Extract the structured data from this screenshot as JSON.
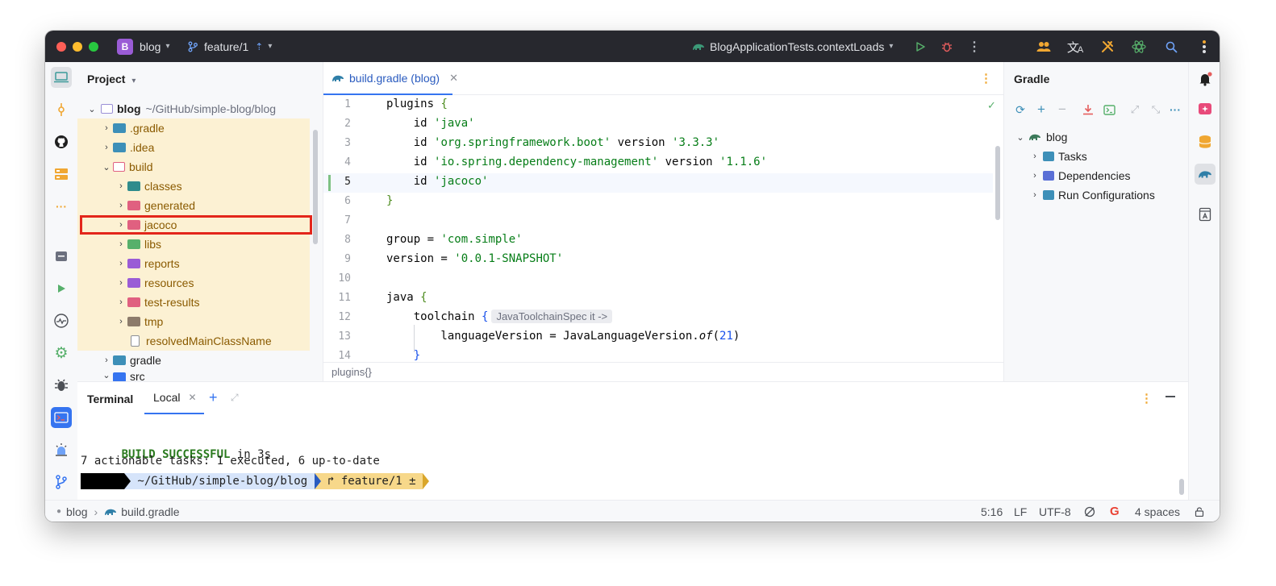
{
  "titlebar": {
    "project_badge": "B",
    "project_name": "blog",
    "branch": "feature/1",
    "run_config": "BlogApplicationTests.contextLoads"
  },
  "project_panel": {
    "title": "Project",
    "tree": [
      {
        "label": "blog",
        "hint": "~/GitHub/simple-blog/blog",
        "expanded": true
      },
      {
        "label": ".gradle"
      },
      {
        "label": ".idea"
      },
      {
        "label": "build",
        "expanded": true
      },
      {
        "label": "classes"
      },
      {
        "label": "generated"
      },
      {
        "label": "jacoco"
      },
      {
        "label": "libs"
      },
      {
        "label": "reports"
      },
      {
        "label": "resources"
      },
      {
        "label": "test-results"
      },
      {
        "label": "tmp"
      },
      {
        "label": "resolvedMainClassName"
      },
      {
        "label": "gradle"
      },
      {
        "label": "src",
        "expanded": true
      }
    ]
  },
  "editor": {
    "tab_label": "build.gradle (blog)",
    "line_numbers": [
      "1",
      "2",
      "3",
      "4",
      "5",
      "6",
      "7",
      "8",
      "9",
      "10",
      "11",
      "12",
      "13",
      "14"
    ],
    "code": {
      "l1_kw": "plugins ",
      "l1_br": "{",
      "l2_a": "    id ",
      "l2_s": "'java'",
      "l3_a": "    id ",
      "l3_s": "'org.springframework.boot'",
      "l3_b": " version ",
      "l3_s2": "'3.3.3'",
      "l4_a": "    id ",
      "l4_s": "'io.spring.dependency-management'",
      "l4_b": " version ",
      "l4_s2": "'1.1.6'",
      "l5_a": "    id ",
      "l5_s": "'jacoco'",
      "l6_br": "}",
      "l8_a": "group = ",
      "l8_s": "'com.simple'",
      "l9_a": "version = ",
      "l9_s": "'0.0.1-SNAPSHOT'",
      "l11_a": "java ",
      "l11_br": "{",
      "l12_a": "    toolchain ",
      "l12_br": "{",
      "l12_hint": "JavaToolchainSpec it ->",
      "l13_a": "        languageVersion = JavaLanguageVersion.",
      "l13_i": "of",
      "l13_p": "(",
      "l13_n": "21",
      "l13_c": ")",
      "l14_br": "    }"
    },
    "breadcrumb": "plugins{}"
  },
  "gradle_panel": {
    "title": "Gradle",
    "tree": [
      {
        "label": "blog",
        "expanded": true
      },
      {
        "label": "Tasks"
      },
      {
        "label": "Dependencies"
      },
      {
        "label": "Run Configurations"
      }
    ]
  },
  "terminal": {
    "title": "Terminal",
    "tab_label": "Local",
    "build_status": "BUILD SUCCESSFUL",
    "build_time": " in 3s",
    "tasks_line": "7 actionable tasks: 1 executed, 6 up-to-date",
    "prompt_path": " ~/GitHub/simple-blog/blog ",
    "prompt_branch": " ↱ feature/1 ± "
  },
  "statusbar": {
    "crumb_root": "blog",
    "crumb_file": "build.gradle",
    "position": "5:16",
    "line_sep": "LF",
    "encoding": "UTF-8",
    "indent": "4 spaces"
  },
  "colors": {
    "accent": "#3574f0",
    "highlight_box": "#e3261b",
    "excluded_bg": "#fcf1d3",
    "string_green": "#067d17"
  }
}
